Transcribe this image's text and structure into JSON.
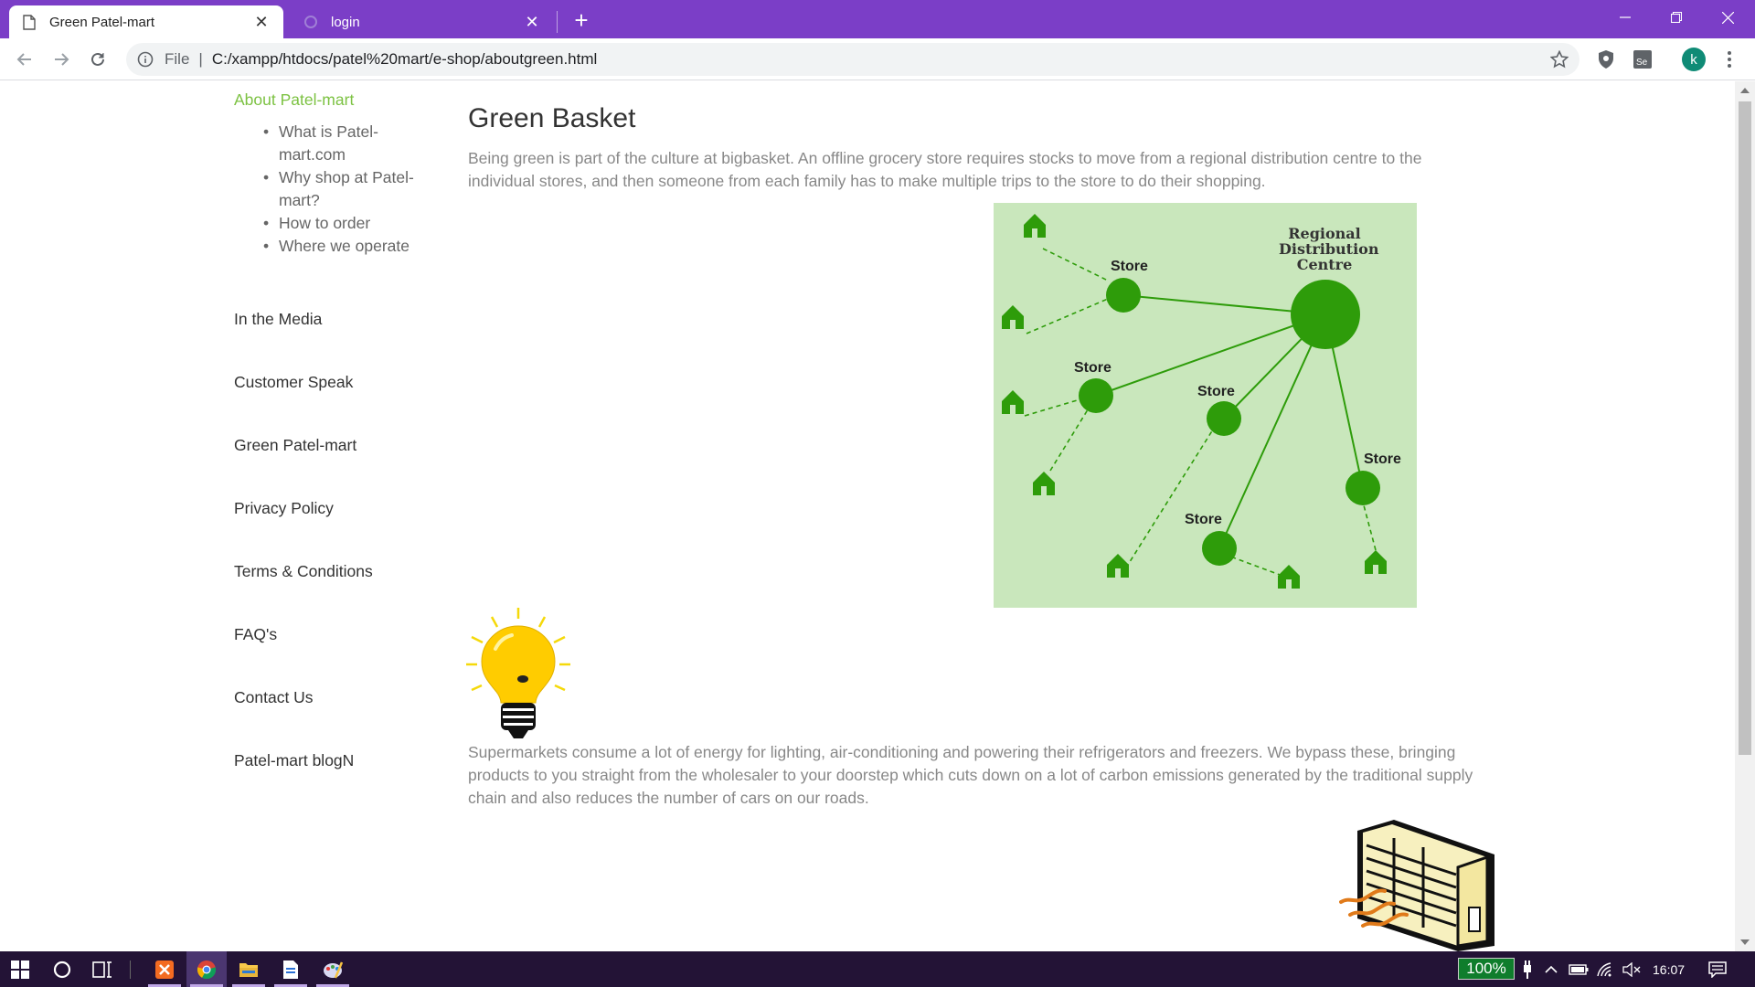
{
  "browser": {
    "tabs": [
      {
        "title": "Green Patel-mart",
        "active": true
      },
      {
        "title": "login",
        "active": false
      }
    ],
    "new_tab_symbol": "+",
    "address": {
      "scheme_label": "File",
      "divider": "|",
      "url": "C:/xampp/htdocs/patel%20mart/e-shop/aboutgreen.html"
    },
    "profile_initial": "k",
    "theme_color": "#7b3ec7"
  },
  "sidebar": {
    "heading": "About Patel-mart",
    "sub_items": [
      "What is Patel-mart.com",
      "Why shop at Patel-mart?",
      "How to order",
      "Where we operate"
    ],
    "links": [
      "In the Media",
      "Customer Speak",
      "Green Patel-mart",
      "Privacy Policy",
      "Terms & Conditions",
      "FAQ's",
      "Contact Us",
      "Patel-mart blogN"
    ],
    "accent_color": "#7cc242"
  },
  "main": {
    "title": "Green Basket",
    "paragraph1": "Being green is part of the culture at bigbasket. An offline grocery store requires stocks to move from a regional distribution centre to the individual stores, and then someone from each family has to make multiple trips to the store to do their shopping.",
    "paragraph2": "Supermarkets consume a lot of energy for lighting, air-conditioning and powering their refrigerators and freezers. We bypass these, bringing products to you straight from the wholesaler to your doorstep which cuts down on a lot of carbon emissions generated by the traditional supply chain and also reduces the number of cars on our roads.",
    "diagram": {
      "centre_label": [
        "Regional",
        "Distribution",
        "Centre"
      ],
      "store_label": "Store",
      "background_color": "#c9e7bc",
      "node_color": "#2e9c0a"
    }
  },
  "taskbar": {
    "battery": "100%",
    "time": "16:07",
    "accent_color": "#231336"
  }
}
